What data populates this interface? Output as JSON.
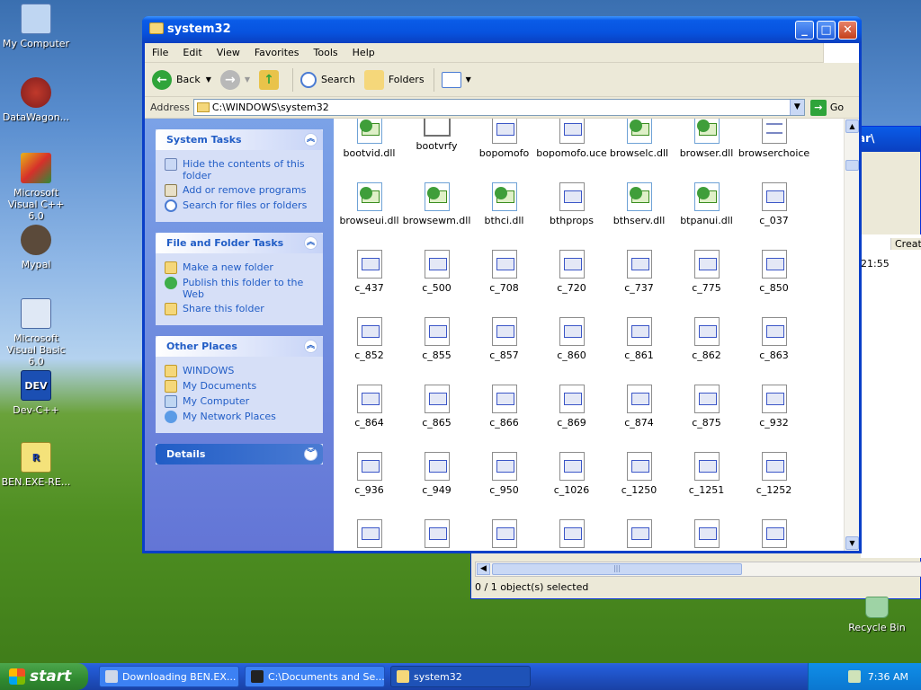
{
  "desktop": {
    "icons": [
      {
        "label": "My Computer"
      },
      {
        "label": "DataWagon..."
      },
      {
        "label": "Microsoft Visual C++ 6.0"
      },
      {
        "label": "Mypal"
      },
      {
        "label": "Microsoft Visual Basic 6.0"
      },
      {
        "label": "Dev-C++"
      },
      {
        "label": "BEN.EXE-RE..."
      }
    ],
    "dev_icon_text": "DEV",
    "ben_icon_text": "R",
    "recycle_bin": "Recycle Bin"
  },
  "bg_window": {
    "title_fragment": "ar\\",
    "column_header": "Create",
    "time_fragment": "21:55",
    "status": "0 / 1 object(s) selected"
  },
  "window": {
    "title": "system32",
    "minimize": "_",
    "maximize": "□",
    "close": "✕",
    "menu": [
      "File",
      "Edit",
      "View",
      "Favorites",
      "Tools",
      "Help"
    ],
    "toolbar": {
      "back": "Back",
      "search": "Search",
      "folders": "Folders"
    },
    "address_label": "Address",
    "address_value": "C:\\WINDOWS\\system32",
    "go": "Go"
  },
  "taskpane": {
    "system_tasks": {
      "title": "System Tasks",
      "items": [
        "Hide the contents of this folder",
        "Add or remove programs",
        "Search for files or folders"
      ]
    },
    "file_tasks": {
      "title": "File and Folder Tasks",
      "items": [
        "Make a new folder",
        "Publish this folder to the Web",
        "Share this folder"
      ]
    },
    "other_places": {
      "title": "Other Places",
      "items": [
        "WINDOWS",
        "My Documents",
        "My Computer",
        "My Network Places"
      ]
    },
    "details": {
      "title": "Details"
    }
  },
  "files": [
    {
      "name": "bootvid.dll",
      "icon": "gear"
    },
    {
      "name": "bootvrfy",
      "icon": "blank"
    },
    {
      "name": "bopomofo",
      "icon": "exe"
    },
    {
      "name": "bopomofo.uce",
      "icon": "exe"
    },
    {
      "name": "browselc.dll",
      "icon": "gear"
    },
    {
      "name": "browser.dll",
      "icon": "gear"
    },
    {
      "name": "browserchoice",
      "icon": "list"
    },
    {
      "name": "browseui.dll",
      "icon": "gear"
    },
    {
      "name": "browsewm.dll",
      "icon": "gear"
    },
    {
      "name": "bthci.dll",
      "icon": "gear"
    },
    {
      "name": "bthprops",
      "icon": "exe"
    },
    {
      "name": "bthserv.dll",
      "icon": "gear"
    },
    {
      "name": "btpanui.dll",
      "icon": "gear"
    },
    {
      "name": "c_037",
      "icon": "exe"
    },
    {
      "name": "c_437",
      "icon": "exe"
    },
    {
      "name": "c_500",
      "icon": "exe"
    },
    {
      "name": "c_708",
      "icon": "exe"
    },
    {
      "name": "c_720",
      "icon": "exe"
    },
    {
      "name": "c_737",
      "icon": "exe"
    },
    {
      "name": "c_775",
      "icon": "exe"
    },
    {
      "name": "c_850",
      "icon": "exe"
    },
    {
      "name": "c_852",
      "icon": "exe"
    },
    {
      "name": "c_855",
      "icon": "exe"
    },
    {
      "name": "c_857",
      "icon": "exe"
    },
    {
      "name": "c_860",
      "icon": "exe"
    },
    {
      "name": "c_861",
      "icon": "exe"
    },
    {
      "name": "c_862",
      "icon": "exe"
    },
    {
      "name": "c_863",
      "icon": "exe"
    },
    {
      "name": "c_864",
      "icon": "exe"
    },
    {
      "name": "c_865",
      "icon": "exe"
    },
    {
      "name": "c_866",
      "icon": "exe"
    },
    {
      "name": "c_869",
      "icon": "exe"
    },
    {
      "name": "c_874",
      "icon": "exe"
    },
    {
      "name": "c_875",
      "icon": "exe"
    },
    {
      "name": "c_932",
      "icon": "exe"
    },
    {
      "name": "c_936",
      "icon": "exe"
    },
    {
      "name": "c_949",
      "icon": "exe"
    },
    {
      "name": "c_950",
      "icon": "exe"
    },
    {
      "name": "c_1026",
      "icon": "exe"
    },
    {
      "name": "c_1250",
      "icon": "exe"
    },
    {
      "name": "c_1251",
      "icon": "exe"
    },
    {
      "name": "c_1252",
      "icon": "exe"
    },
    {
      "name": "",
      "icon": "exe"
    },
    {
      "name": "",
      "icon": "exe"
    },
    {
      "name": "",
      "icon": "exe"
    },
    {
      "name": "",
      "icon": "exe"
    },
    {
      "name": "",
      "icon": "exe"
    },
    {
      "name": "",
      "icon": "exe"
    },
    {
      "name": "",
      "icon": "exe"
    }
  ],
  "taskbar": {
    "start": "start",
    "tasks": [
      {
        "label": "Downloading BEN.EX...",
        "active": false
      },
      {
        "label": "C:\\Documents and Se...",
        "active": false
      },
      {
        "label": "system32",
        "active": true
      }
    ],
    "clock": "7:36 AM"
  },
  "colors": {
    "accent": "#0a5ce8",
    "taskpane": "#7ba2e7",
    "link": "#215dc6"
  }
}
